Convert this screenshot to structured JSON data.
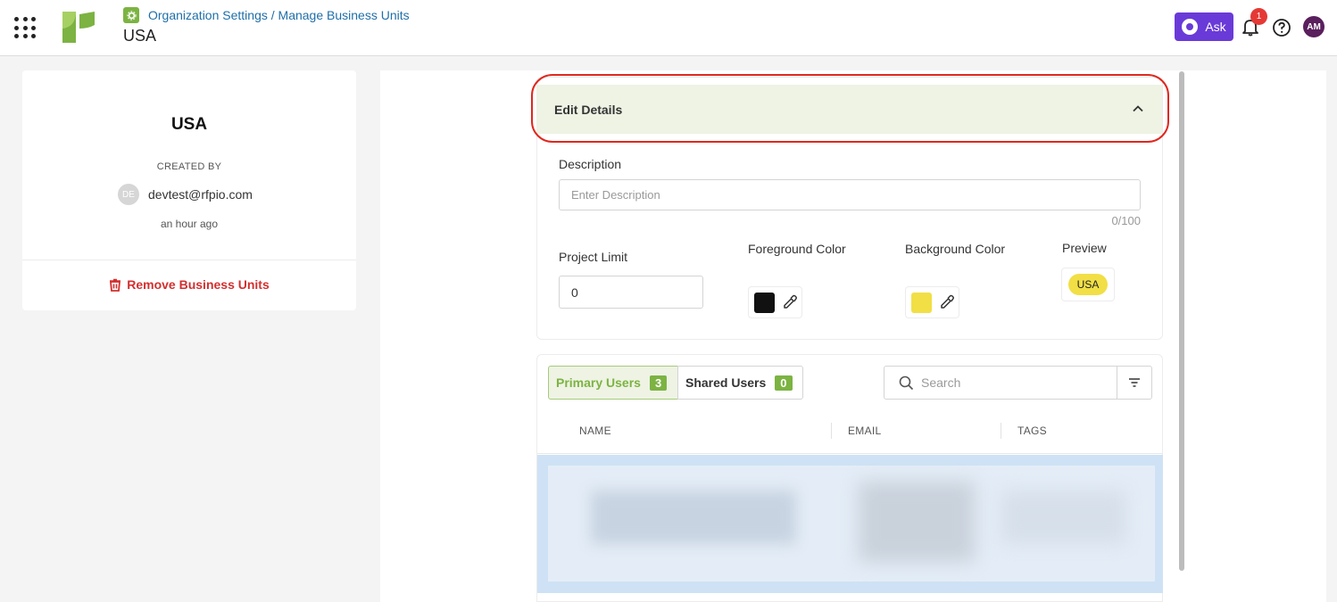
{
  "header": {
    "breadcrumb_parent": "Organization Settings",
    "breadcrumb_sep": " / ",
    "breadcrumb_current": "Manage Business Units",
    "page_title": "USA",
    "ask_label": "Ask",
    "notification_count": "1",
    "avatar_initials": "AM",
    "brand_color": "#7cb342",
    "ask_color": "#6a3ad8"
  },
  "unit_card": {
    "name": "USA",
    "created_by_label": "CREATED BY",
    "creator_initials": "DE",
    "creator_email": "devtest@rfpio.com",
    "created_time": "an hour ago",
    "remove_label": "Remove Business Units"
  },
  "edit_details": {
    "title": "Edit Details",
    "description_label": "Description",
    "description_placeholder": "Enter Description",
    "description_value": "",
    "char_count": "0/100",
    "project_limit_label": "Project Limit",
    "project_limit_value": "0",
    "foreground_label": "Foreground Color",
    "foreground_color": "#111111",
    "background_label": "Background Color",
    "background_color": "#f1df45",
    "preview_label": "Preview",
    "preview_text": "USA"
  },
  "users": {
    "tabs": [
      {
        "label": "Primary Users",
        "count": "3",
        "active": true
      },
      {
        "label": "Shared Users",
        "count": "0",
        "active": false
      }
    ],
    "search_placeholder": "Search",
    "columns": [
      "NAME",
      "EMAIL",
      "TAGS"
    ]
  }
}
